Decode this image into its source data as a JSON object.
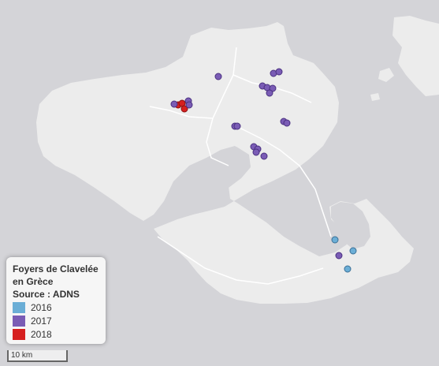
{
  "legend": {
    "title_line1": "Foyers de Clavelée",
    "title_line2": "en Grèce",
    "title_line3": "Source : ADNS",
    "items": [
      {
        "label": "2016",
        "color": "#6baed6"
      },
      {
        "label": "2017",
        "color": "#7a5cb5"
      },
      {
        "label": "2018",
        "color": "#d62020"
      }
    ]
  },
  "scale_label": "10 km",
  "colors": {
    "sea": "#d4d4d8",
    "land": "#ececec",
    "road": "#ffffff"
  }
}
